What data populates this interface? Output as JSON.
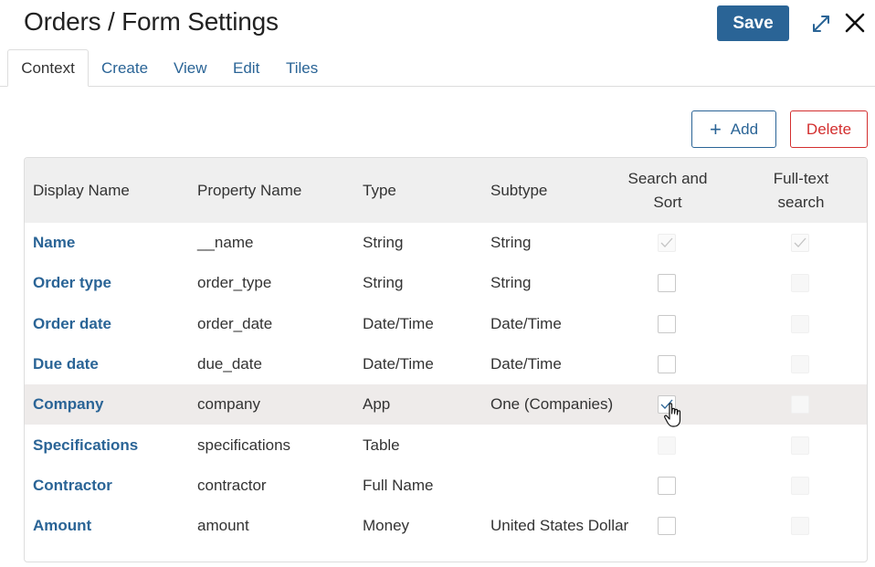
{
  "header": {
    "title": "Orders / Form Settings",
    "save_label": "Save"
  },
  "tabs": [
    {
      "label": "Context",
      "active": true
    },
    {
      "label": "Create",
      "active": false
    },
    {
      "label": "View",
      "active": false
    },
    {
      "label": "Edit",
      "active": false
    },
    {
      "label": "Tiles",
      "active": false
    }
  ],
  "toolbar": {
    "add_label": "Add",
    "add_icon": "plus-icon",
    "delete_label": "Delete"
  },
  "table": {
    "columns": {
      "display_name": "Display Name",
      "property_name": "Property Name",
      "type": "Type",
      "subtype": "Subtype",
      "search_sort_line1": "Search and",
      "search_sort_line2": "Sort",
      "fulltext_line1": "Full-text",
      "fulltext_line2": "search"
    },
    "rows": [
      {
        "display_name": "Name",
        "property_name": "__name",
        "type": "String",
        "subtype": "String",
        "search_sort": "checked-disabled",
        "fulltext": "checked-disabled"
      },
      {
        "display_name": "Order type",
        "property_name": "order_type",
        "type": "String",
        "subtype": "String",
        "search_sort": "unchecked",
        "fulltext": "disabled"
      },
      {
        "display_name": "Order date",
        "property_name": "order_date",
        "type": "Date/Time",
        "subtype": "Date/Time",
        "search_sort": "unchecked",
        "fulltext": "disabled"
      },
      {
        "display_name": "Due date",
        "property_name": "due_date",
        "type": "Date/Time",
        "subtype": "Date/Time",
        "search_sort": "unchecked",
        "fulltext": "disabled"
      },
      {
        "display_name": "Company",
        "property_name": "company",
        "type": "App",
        "subtype": "One (Companies)",
        "search_sort": "checked",
        "fulltext": "disabled",
        "highlighted": true
      },
      {
        "display_name": "Specifications",
        "property_name": "specifications",
        "type": "Table",
        "subtype": "",
        "search_sort": "disabled",
        "fulltext": "disabled"
      },
      {
        "display_name": "Contractor",
        "property_name": "contractor",
        "type": "Full Name",
        "subtype": "",
        "search_sort": "unchecked",
        "fulltext": "disabled"
      },
      {
        "display_name": "Amount",
        "property_name": "amount",
        "type": "Money",
        "subtype": "United States Dollar",
        "search_sort": "unchecked",
        "fulltext": "disabled"
      }
    ]
  },
  "colors": {
    "accent": "#2a6496",
    "danger": "#d32f2f",
    "header_bg": "#efefef",
    "row_highlight": "#eeebea"
  }
}
